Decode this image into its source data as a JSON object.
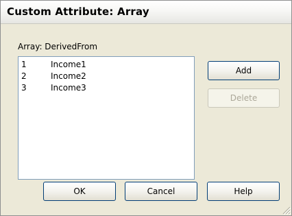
{
  "window": {
    "title": "Custom Attribute: Array"
  },
  "array_label": "Array: DerivedFrom",
  "list": [
    {
      "index": "1",
      "value": "Income1"
    },
    {
      "index": "2",
      "value": "Income2"
    },
    {
      "index": "3",
      "value": "Income3"
    }
  ],
  "buttons": {
    "add": "Add",
    "delete": "Delete",
    "ok": "OK",
    "cancel": "Cancel",
    "help": "Help"
  },
  "states": {
    "delete_enabled": false
  },
  "icons": [
    "resize-grip-icon"
  ]
}
